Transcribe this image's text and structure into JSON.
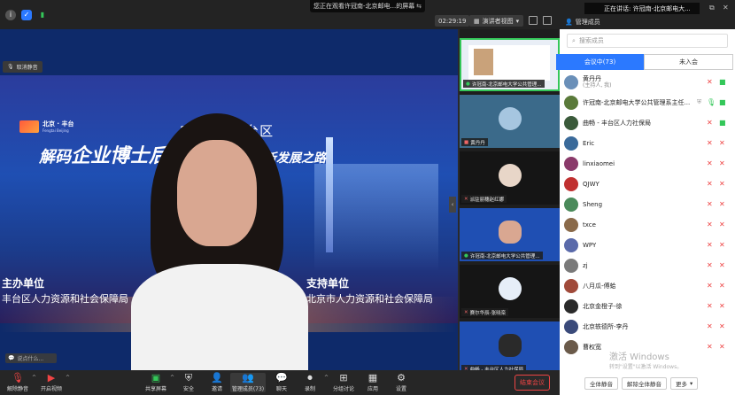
{
  "notice_text": "您正在观看许冠南-北京邮电...的屏幕",
  "timer": "02:29:19",
  "view_mode": "演讲者视图",
  "mute_chip": "取消静音",
  "speak_placeholder": "说点什么...",
  "slide": {
    "logo_name": "北京 · 丰台",
    "logo_pinyin": "Fengtai Beijing",
    "year_line": "2022年丰台区",
    "title_a": "解码",
    "title_b": "企业博士后工作站",
    "title_c": "科研创新发展之路",
    "host_heading": "主办单位",
    "host_org": "丰台区人力资源和社会保障局",
    "support_heading": "支持单位",
    "support_org": "北京市人力资源和社会保障局"
  },
  "thumbnails": [
    {
      "label": "许冠南-北京邮电大学公共管理..."
    },
    {
      "label": "黄丹丹"
    },
    {
      "label": "派驻丽穗赵红娜"
    },
    {
      "label": "许冠南-北京邮电大学公共管理..."
    },
    {
      "label": "赛尔华辰-张晓栾"
    },
    {
      "label": "曲畅 - 丰台区人力社保局"
    }
  ],
  "panel": {
    "speaking": "正在讲话: 许冠南-北京邮电大...",
    "title": "管理成员",
    "search_placeholder": "搜索成员",
    "tab_in": "会议中(73)",
    "tab_wait": "未入会",
    "members": [
      {
        "name": "黄丹丹",
        "sub": "(主持人, 我)",
        "avatar": "#6a8fb8",
        "mic": "muted",
        "cam": "on"
      },
      {
        "name": "许冠南-北京邮电大学公共管理系主任...",
        "sub": "",
        "avatar": "#5a7a3a",
        "mic": "on",
        "cam": "on",
        "shield": true
      },
      {
        "name": "曲畅 - 丰台区人力社保局",
        "sub": "",
        "avatar": "#3a5a3a",
        "mic": "muted",
        "cam": "on"
      },
      {
        "name": "Eric",
        "sub": "",
        "avatar": "#3a6a9a",
        "mic": "muted",
        "cam": "muted"
      },
      {
        "name": "linxiaomei",
        "sub": "",
        "avatar": "#8a3a6a",
        "mic": "muted",
        "cam": "muted"
      },
      {
        "name": "QJWY",
        "sub": "",
        "avatar": "#c03030",
        "mic": "muted",
        "cam": "muted"
      },
      {
        "name": "Sheng",
        "sub": "",
        "avatar": "#4a8a5a",
        "mic": "muted",
        "cam": "muted"
      },
      {
        "name": "txce",
        "sub": "",
        "avatar": "#8a6a4a",
        "mic": "muted",
        "cam": "muted"
      },
      {
        "name": "WPY",
        "sub": "",
        "avatar": "#5a6aaa",
        "mic": "muted",
        "cam": "muted"
      },
      {
        "name": "zj",
        "sub": "",
        "avatar": "#7a7a7a",
        "mic": "muted",
        "cam": "muted"
      },
      {
        "name": "八月瓜-傅蛤",
        "sub": "",
        "avatar": "#a04a3a",
        "mic": "muted",
        "cam": "muted"
      },
      {
        "name": "北京金橙子-徐",
        "sub": "",
        "avatar": "#2a2a2a",
        "mic": "muted",
        "cam": "muted"
      },
      {
        "name": "北京轶德所-李丹",
        "sub": "",
        "avatar": "#3a4a7a",
        "mic": "muted",
        "cam": "muted"
      },
      {
        "name": "曹权宽",
        "sub": "",
        "avatar": "#6a5a4a",
        "mic": "muted",
        "cam": "muted"
      }
    ],
    "mute_all": "全体静音",
    "unmute_all": "解除全体静音",
    "more": "更多"
  },
  "activate_line1": "激活 Windows",
  "activate_line2": "转到\"设置\"以激活 Windows。",
  "toolbar": {
    "unmute": "解除静音",
    "start_video": "开启视频",
    "share": "共享屏幕",
    "security": "安全",
    "invite": "邀请",
    "members": "管理成员(73)",
    "chat": "聊天",
    "record": "录制",
    "breakout": "分组讨论",
    "apps": "应用",
    "settings": "设置",
    "end": "结束会议"
  },
  "colors": {
    "accent": "#2b79ff",
    "end": "#e44444",
    "active_green": "#34c759"
  }
}
